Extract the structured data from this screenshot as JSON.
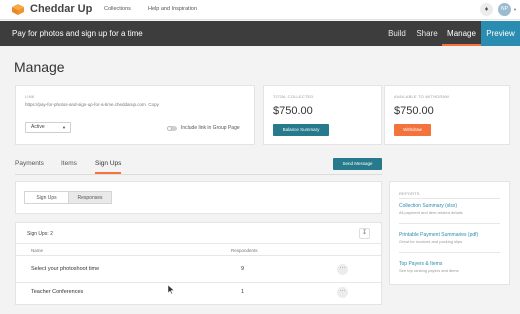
{
  "topnav": {
    "brand": "Cheddar Up",
    "links": [
      "Collections",
      "Help and Inspiration"
    ],
    "notif_icon": "gift-icon",
    "avatar_initials": "NP"
  },
  "titlebar": {
    "title": "Pay for photos and sign up for a time",
    "tabs": [
      "Build",
      "Share",
      "Manage",
      "Preview"
    ],
    "active_tab": "Manage"
  },
  "page_title": "Manage",
  "link_card": {
    "label": "LINK",
    "url": "https://pay-for-photos-and-sign-up-for-a-time.cheddarup.com",
    "copy": "Copy",
    "status": "Active",
    "toggle_label": "Include link in Group Page",
    "toggle_on": false
  },
  "collected_card": {
    "label": "TOTAL COLLECTED",
    "amount": "$750.00",
    "button": "Balance Summary"
  },
  "withdraw_card": {
    "label": "AVAILABLE TO WITHDRAW",
    "amount": "$750.00",
    "button": "Withdraw"
  },
  "tabs": [
    "Payments",
    "Items",
    "Sign Ups"
  ],
  "active_tab": "Sign Ups",
  "send_message": "Send Message",
  "signups": {
    "segments": [
      "Sign Ups",
      "Responses"
    ],
    "count_label": "Sign Ups: 2",
    "columns": [
      "Name",
      "Respondents"
    ],
    "rows": [
      {
        "name": "Select your photoshoot time",
        "respondents": "9"
      },
      {
        "name": "Teacher Conferences",
        "respondents": "1"
      }
    ]
  },
  "reports": {
    "heading": "REPORTS",
    "items": [
      {
        "title": "Collection Summary (xlsx)",
        "subtitle": "All payment and item-related details"
      },
      {
        "title": "Printable Payment Summaries (pdf)",
        "subtitle": "Great for invoices and packing slips"
      },
      {
        "title": "Top Payers & Items",
        "subtitle": "See top ranking payers and items"
      }
    ]
  },
  "colors": {
    "accent": "#f4723b",
    "teal": "#267a8c",
    "preview": "#2b8cb1",
    "bar": "#3d3d3d"
  }
}
